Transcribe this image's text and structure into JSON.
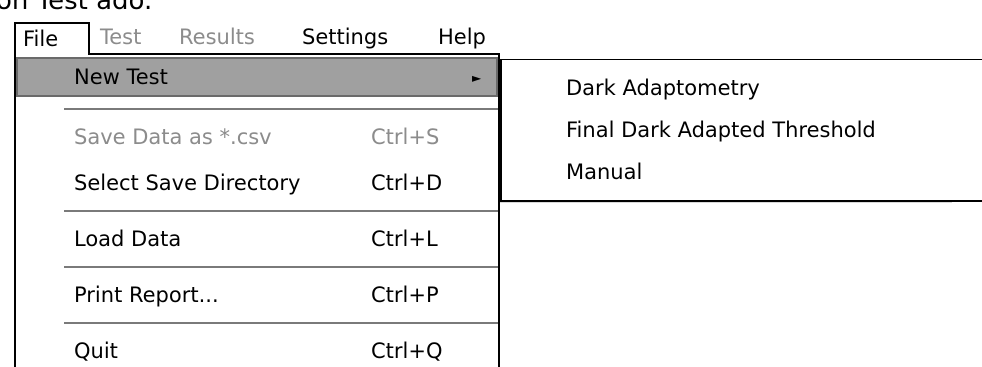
{
  "window": {
    "title_fragment": "on Test ado."
  },
  "menubar": {
    "items": [
      {
        "label": "File",
        "state": "open"
      },
      {
        "label": "Test",
        "state": "disabled"
      },
      {
        "label": "Results",
        "state": "disabled"
      },
      {
        "label": "Settings",
        "state": "enabled"
      },
      {
        "label": "Help",
        "state": "enabled"
      }
    ]
  },
  "file_menu": {
    "items": [
      {
        "label": "New Test",
        "shortcut": "",
        "submenu_arrow": "►",
        "state": "highlighted"
      },
      {
        "label": "Save Data as *.csv",
        "shortcut": "Ctrl+S",
        "state": "disabled"
      },
      {
        "label": "Select Save Directory",
        "shortcut": "Ctrl+D",
        "state": "enabled"
      },
      {
        "label": "Load Data",
        "shortcut": "Ctrl+L",
        "state": "enabled"
      },
      {
        "label": "Print Report...",
        "shortcut": "Ctrl+P",
        "state": "enabled"
      },
      {
        "label": "Quit",
        "shortcut": "Ctrl+Q",
        "state": "enabled"
      }
    ]
  },
  "new_test_submenu": {
    "items": [
      {
        "label": "Dark Adaptometry"
      },
      {
        "label": "Final Dark Adapted Threshold"
      },
      {
        "label": "Manual"
      }
    ]
  },
  "colors": {
    "highlight_bg": "#a0a0a0",
    "disabled_text": "#8c8c8c",
    "separator": "#7a7a7a"
  }
}
